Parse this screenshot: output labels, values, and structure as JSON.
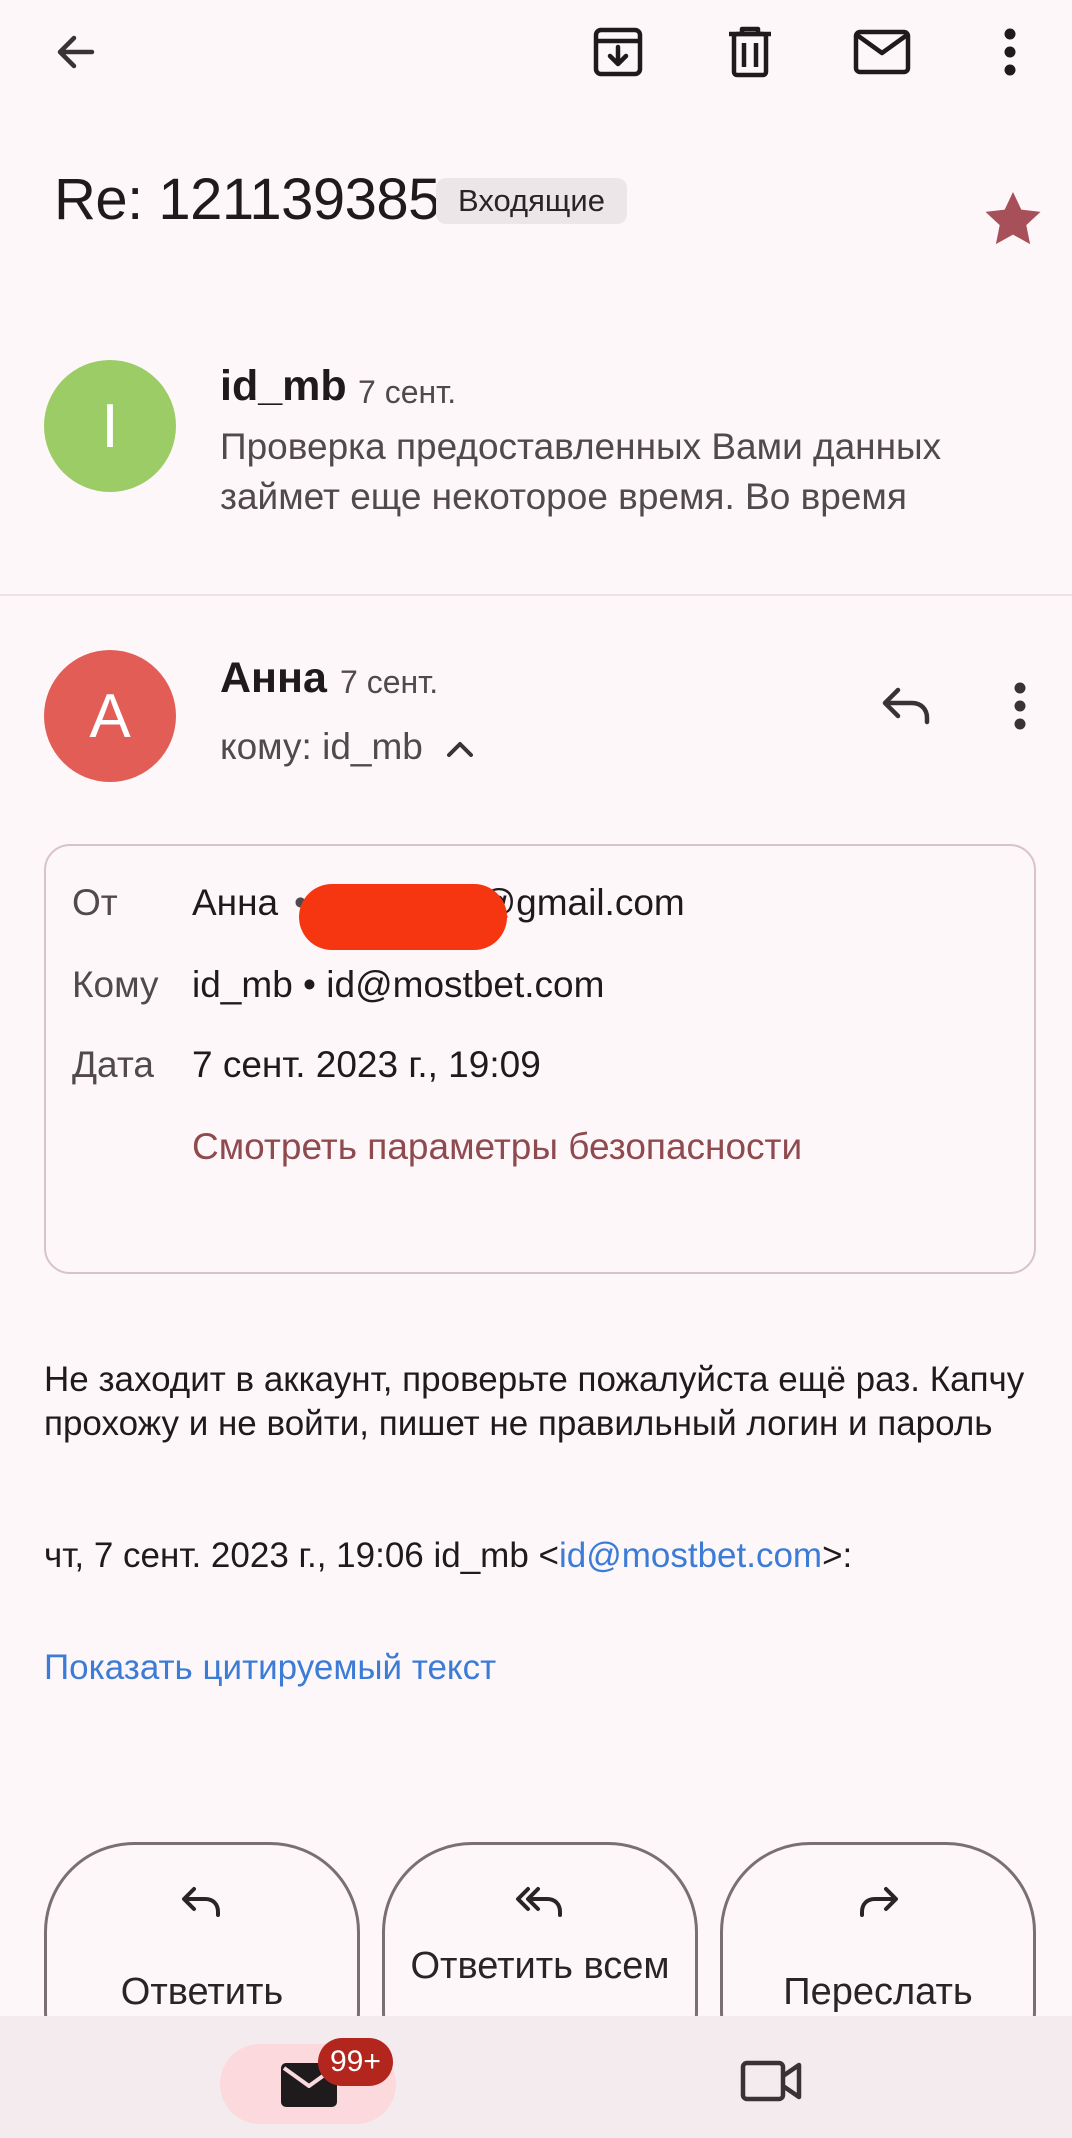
{
  "toolbar": {
    "back_icon": "arrow-left-icon",
    "archive_icon": "archive-icon",
    "delete_icon": "trash-icon",
    "mark_unread_icon": "envelope-icon",
    "more_icon": "more-vertical-icon"
  },
  "thread": {
    "subject": "Re: 121139385",
    "label": "Входящие",
    "star_icon": "star-icon",
    "star_color": "#a8505a"
  },
  "collapsed_message": {
    "avatar_letter": "I",
    "avatar_color": "#9ccc65",
    "sender": "id_mb",
    "date": "7 сент.",
    "snippet": "Проверка предоставленных Вами данных займет еще некоторое время. Во время"
  },
  "message": {
    "avatar_letter": "А",
    "avatar_color": "#e35d57",
    "sender": "Анна",
    "date": "7 сент.",
    "to_line": "кому: id_mb",
    "details": {
      "from_label": "От",
      "from_name": "Анна",
      "from_email_visible": "0@gmail.com",
      "to_label": "Кому",
      "to_value": "id_mb • id@mostbet.com",
      "date_label": "Дата",
      "date_value": "7 сент. 2023 г., 19:09",
      "security_link": "Смотреть параметры безопасности"
    },
    "body": "Не заходит в аккаунт, проверьте пожалуйста ещё раз. Капчу прохожу и не войти, пишет не правильный логин и пароль",
    "quote_prefix": "чт, 7 сент. 2023 г., 19:06 id_mb <",
    "quote_email": "id@mostbet.com",
    "quote_suffix": ">:",
    "show_quoted": "Показать цитируемый текст"
  },
  "actions": {
    "reply": "Ответить",
    "reply_all": "Ответить всем",
    "forward": "Переслать"
  },
  "bottom_nav": {
    "mail_badge": "99+",
    "mail_icon": "envelope-icon",
    "meet_icon": "video-camera-icon"
  }
}
